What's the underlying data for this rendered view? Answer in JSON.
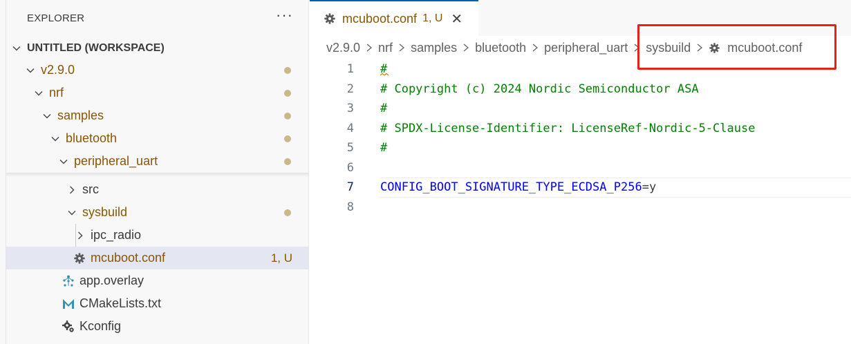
{
  "explorer": {
    "title": "EXPLORER",
    "more": "···",
    "workspace": "UNTITLED (WORKSPACE)",
    "items": [
      {
        "label": "v2.9.0"
      },
      {
        "label": "nrf"
      },
      {
        "label": "samples"
      },
      {
        "label": "bluetooth"
      },
      {
        "label": "peripheral_uart"
      },
      {
        "label": "src"
      },
      {
        "label": "sysbuild"
      },
      {
        "label": "ipc_radio"
      },
      {
        "label": "mcuboot.conf",
        "badge": "1, U"
      },
      {
        "label": "app.overlay"
      },
      {
        "label": "CMakeLists.txt"
      },
      {
        "label": "Kconfig"
      }
    ]
  },
  "tab": {
    "label": "mcuboot.conf",
    "badge": "1, U",
    "close": "✕"
  },
  "breadcrumb": [
    "v2.9.0",
    "nrf",
    "samples",
    "bluetooth",
    "peripheral_uart",
    "sysbuild",
    "mcuboot.conf"
  ],
  "code": {
    "lines": [
      {
        "no": "1",
        "text": "#"
      },
      {
        "no": "2",
        "text": "# Copyright (c) 2024 Nordic Semiconductor ASA"
      },
      {
        "no": "3",
        "text": "#"
      },
      {
        "no": "4",
        "text": "# SPDX-License-Identifier: LicenseRef-Nordic-5-Clause"
      },
      {
        "no": "5",
        "text": "#"
      },
      {
        "no": "6",
        "text": ""
      },
      {
        "no": "7",
        "key": "CONFIG_BOOT_SIGNATURE_TYPE_ECDSA_P256",
        "value": "=y"
      },
      {
        "no": "8",
        "text": ""
      }
    ]
  },
  "colors": {
    "modified": "#895503",
    "comment": "#008000",
    "keyword": "#0000ff",
    "highlight": "#e8201a",
    "accent": "#005fb8"
  }
}
